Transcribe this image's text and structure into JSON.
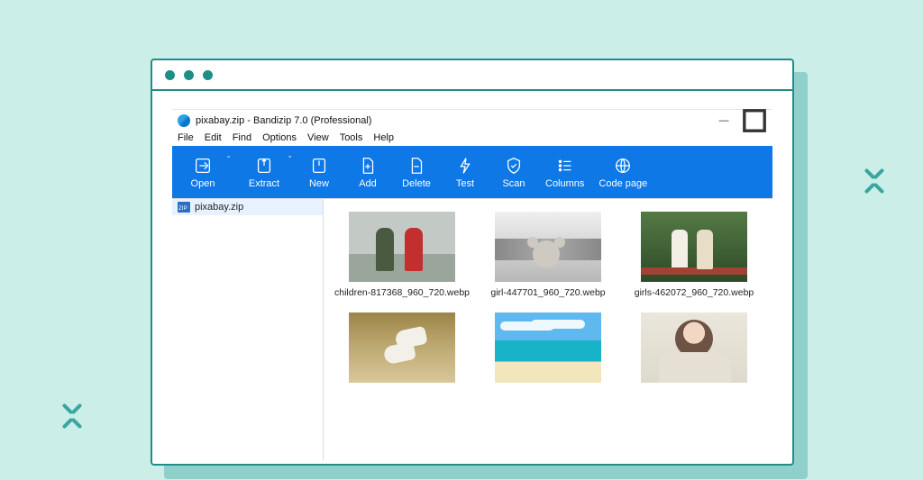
{
  "app": {
    "title": "pixabay.zip - Bandizip 7.0 (Professional)",
    "menubar": [
      "File",
      "Edit",
      "Find",
      "Options",
      "View",
      "Tools",
      "Help"
    ],
    "toolbar": [
      {
        "id": "open",
        "label": "Open",
        "has_dropdown": true
      },
      {
        "id": "extract",
        "label": "Extract",
        "has_dropdown": true
      },
      {
        "id": "new",
        "label": "New"
      },
      {
        "id": "add",
        "label": "Add"
      },
      {
        "id": "delete",
        "label": "Delete"
      },
      {
        "id": "test",
        "label": "Test"
      },
      {
        "id": "scan",
        "label": "Scan"
      },
      {
        "id": "columns",
        "label": "Columns"
      },
      {
        "id": "codepage",
        "label": "Code page"
      }
    ],
    "tree": {
      "root_label": "pixabay.zip"
    },
    "files": [
      {
        "name": "children-817368_960_720.webp"
      },
      {
        "name": "girl-447701_960_720.webp"
      },
      {
        "name": "girls-462072_960_720.webp"
      },
      {
        "name": ""
      },
      {
        "name": ""
      },
      {
        "name": ""
      }
    ],
    "win_controls": {
      "minimize": "—",
      "maximize": "▢"
    }
  }
}
